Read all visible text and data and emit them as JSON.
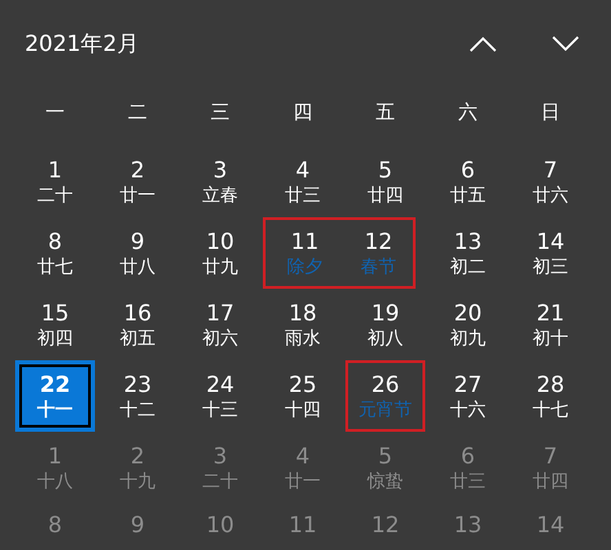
{
  "header": {
    "title": "2021年2月"
  },
  "weekdays": [
    "一",
    "二",
    "三",
    "四",
    "五",
    "六",
    "日"
  ],
  "weeks": [
    [
      {
        "kind": "plain",
        "day": "1",
        "lunar": "二十",
        "in_month": true,
        "today": false,
        "highlighted": false
      },
      {
        "kind": "plain",
        "day": "2",
        "lunar": "廿一",
        "in_month": true,
        "today": false,
        "highlighted": false
      },
      {
        "kind": "plain",
        "day": "3",
        "lunar": "立春",
        "in_month": true,
        "today": false,
        "highlighted": false
      },
      {
        "kind": "plain",
        "day": "4",
        "lunar": "廿三",
        "in_month": true,
        "today": false,
        "highlighted": false
      },
      {
        "kind": "plain",
        "day": "5",
        "lunar": "廿四",
        "in_month": true,
        "today": false,
        "highlighted": false
      },
      {
        "kind": "plain",
        "day": "6",
        "lunar": "廿五",
        "in_month": true,
        "today": false,
        "highlighted": false
      },
      {
        "kind": "plain",
        "day": "7",
        "lunar": "廿六",
        "in_month": true,
        "today": false,
        "highlighted": false
      }
    ],
    [
      {
        "kind": "plain",
        "day": "8",
        "lunar": "廿七",
        "in_month": true,
        "today": false,
        "highlighted": false
      },
      {
        "kind": "plain",
        "day": "9",
        "lunar": "廿八",
        "in_month": true,
        "today": false,
        "highlighted": false
      },
      {
        "kind": "plain",
        "day": "10",
        "lunar": "廿九",
        "in_month": true,
        "today": false,
        "highlighted": false
      },
      {
        "kind": "festival",
        "day": "11",
        "lunar": "除夕",
        "in_month": true,
        "today": false,
        "highlighted": true
      },
      {
        "kind": "festival",
        "day": "12",
        "lunar": "春节",
        "in_month": true,
        "today": false,
        "highlighted": true
      },
      {
        "kind": "plain",
        "day": "13",
        "lunar": "初二",
        "in_month": true,
        "today": false,
        "highlighted": false
      },
      {
        "kind": "plain",
        "day": "14",
        "lunar": "初三",
        "in_month": true,
        "today": false,
        "highlighted": false
      }
    ],
    [
      {
        "kind": "plain",
        "day": "15",
        "lunar": "初四",
        "in_month": true,
        "today": false,
        "highlighted": false
      },
      {
        "kind": "plain",
        "day": "16",
        "lunar": "初五",
        "in_month": true,
        "today": false,
        "highlighted": false
      },
      {
        "kind": "plain",
        "day": "17",
        "lunar": "初六",
        "in_month": true,
        "today": false,
        "highlighted": false
      },
      {
        "kind": "plain",
        "day": "18",
        "lunar": "雨水",
        "in_month": true,
        "today": false,
        "highlighted": false
      },
      {
        "kind": "plain",
        "day": "19",
        "lunar": "初八",
        "in_month": true,
        "today": false,
        "highlighted": false
      },
      {
        "kind": "plain",
        "day": "20",
        "lunar": "初九",
        "in_month": true,
        "today": false,
        "highlighted": false
      },
      {
        "kind": "plain",
        "day": "21",
        "lunar": "初十",
        "in_month": true,
        "today": false,
        "highlighted": false
      }
    ],
    [
      {
        "kind": "plain",
        "day": "22",
        "lunar": "十一",
        "in_month": true,
        "today": true,
        "highlighted": false
      },
      {
        "kind": "plain",
        "day": "23",
        "lunar": "十二",
        "in_month": true,
        "today": false,
        "highlighted": false
      },
      {
        "kind": "plain",
        "day": "24",
        "lunar": "十三",
        "in_month": true,
        "today": false,
        "highlighted": false
      },
      {
        "kind": "plain",
        "day": "25",
        "lunar": "十四",
        "in_month": true,
        "today": false,
        "highlighted": false
      },
      {
        "kind": "festival",
        "day": "26",
        "lunar": "元宵节",
        "in_month": true,
        "today": false,
        "highlighted": true
      },
      {
        "kind": "plain",
        "day": "27",
        "lunar": "十六",
        "in_month": true,
        "today": false,
        "highlighted": false
      },
      {
        "kind": "plain",
        "day": "28",
        "lunar": "十七",
        "in_month": true,
        "today": false,
        "highlighted": false
      }
    ],
    [
      {
        "kind": "plain",
        "day": "1",
        "lunar": "十八",
        "in_month": false,
        "today": false,
        "highlighted": false
      },
      {
        "kind": "plain",
        "day": "2",
        "lunar": "十九",
        "in_month": false,
        "today": false,
        "highlighted": false
      },
      {
        "kind": "plain",
        "day": "3",
        "lunar": "二十",
        "in_month": false,
        "today": false,
        "highlighted": false
      },
      {
        "kind": "plain",
        "day": "4",
        "lunar": "廿一",
        "in_month": false,
        "today": false,
        "highlighted": false
      },
      {
        "kind": "plain",
        "day": "5",
        "lunar": "惊蛰",
        "in_month": false,
        "today": false,
        "highlighted": false
      },
      {
        "kind": "plain",
        "day": "6",
        "lunar": "廿三",
        "in_month": false,
        "today": false,
        "highlighted": false
      },
      {
        "kind": "plain",
        "day": "7",
        "lunar": "廿四",
        "in_month": false,
        "today": false,
        "highlighted": false
      }
    ],
    [
      {
        "day": "8",
        "in_month": false,
        "today": false,
        "highlighted": false
      },
      {
        "day": "9",
        "in_month": false,
        "today": false,
        "highlighted": false
      },
      {
        "day": "10",
        "in_month": false,
        "today": false,
        "highlighted": false
      },
      {
        "day": "11",
        "in_month": false,
        "today": false,
        "highlighted": false
      },
      {
        "day": "12",
        "in_month": false,
        "today": false,
        "highlighted": false
      },
      {
        "day": "13",
        "in_month": false,
        "today": false,
        "highlighted": false
      },
      {
        "day": "14",
        "in_month": false,
        "today": false,
        "highlighted": false
      }
    ]
  ]
}
